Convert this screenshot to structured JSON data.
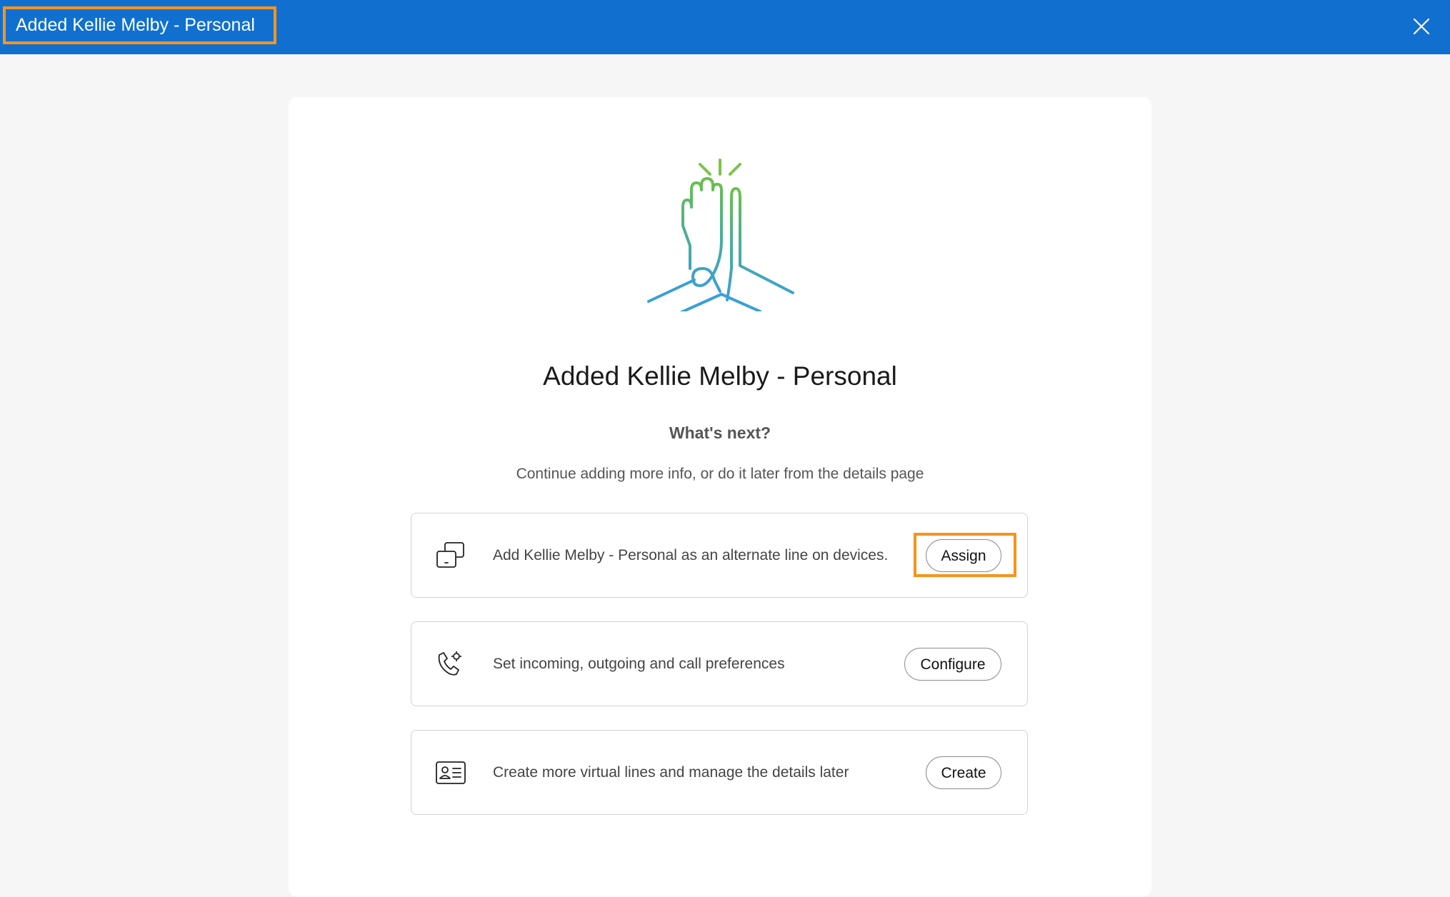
{
  "header": {
    "title": "Added Kellie Melby - Personal",
    "close_icon": "close-icon",
    "background_color": "#1170cf"
  },
  "main": {
    "illustration": "high-five-icon",
    "headline": "Added Kellie Melby - Personal",
    "subheading": "What's next?",
    "description": "Continue adding more info, or do it later from the details page"
  },
  "options": [
    {
      "icon": "devices-icon",
      "text": "Add Kellie Melby - Personal as an alternate line on devices.",
      "button_label": "Assign"
    },
    {
      "icon": "call-settings-icon",
      "text": "Set incoming, outgoing and call preferences",
      "button_label": "Configure"
    },
    {
      "icon": "contact-card-icon",
      "text": "Create more virtual lines and manage the details later",
      "button_label": "Create"
    }
  ],
  "colors": {
    "accent": "#1170cf",
    "highlight": "#f7941d",
    "illustration_green": "#6cc04a",
    "illustration_blue": "#3a9fd8"
  }
}
